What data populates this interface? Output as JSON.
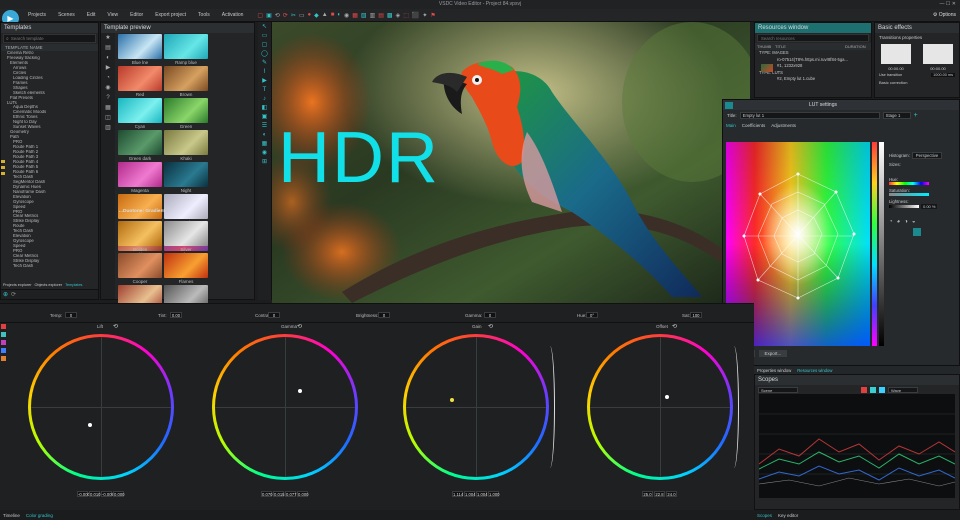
{
  "app": {
    "title": "VSDC Video Editor - Project 84.vpsvj"
  },
  "menu": [
    "Projects",
    "Scenes",
    "Edit",
    "View",
    "Editor",
    "Export project",
    "Tools",
    "Activation"
  ],
  "options_label": "Options",
  "templates": {
    "title": "Templates",
    "search_placeholder": "Search template",
    "header": "TEMPLATE NAME",
    "items": [
      "Cinema Retro",
      "Freeway tracking",
      "Elements",
      "Arrows",
      "Circles",
      "Loading Circles",
      "Frames",
      "Shapes",
      "Sketch elements",
      "Flat Presets",
      "LUTs",
      "Aqua Depths",
      "Cinematic Moods",
      "Ethnic Tones",
      "Night to Day",
      "Sunset Waves",
      "Geometry",
      "Path",
      "PRO",
      "Route Path 1",
      "Route Path 2",
      "Route Path 3",
      "Route Path 4",
      "Route Path 5",
      "Route Path 6",
      "Tech Dash",
      "SegMentor Dash",
      "Dynamic Hues",
      "Nanoframe Dash",
      "Elevation",
      "Gyroscope",
      "Speed",
      "PRO",
      "Clear Metrics",
      "Strike Display",
      "Route",
      "Tech Dash",
      "Elevation",
      "Gyroscope",
      "Speed",
      "PRO",
      "Clear Metrics",
      "Strike Display",
      "Tech Dash"
    ],
    "tabs": [
      "Projects explorer",
      "Objects explorer",
      "Templates"
    ]
  },
  "preview": {
    "title": "Template preview",
    "thumbs": [
      {
        "name": "Blue lne",
        "c1": "#2a6fa8",
        "c2": "#c8e6f5"
      },
      {
        "name": "Ramp blue",
        "c1": "#1fa7b8",
        "c2": "#66e6e6"
      },
      {
        "name": "Red",
        "c1": "#b83a2a",
        "c2": "#f28a6a"
      },
      {
        "name": "Brown",
        "c1": "#7a4a22",
        "c2": "#d6a060"
      },
      {
        "name": "Cyan",
        "c1": "#18b6c0",
        "c2": "#7cf0ee"
      },
      {
        "name": "Green",
        "c1": "#2a7a2a",
        "c2": "#8ad66a"
      },
      {
        "name": "Green dark",
        "c1": "#1e4a30",
        "c2": "#5a9a6a"
      },
      {
        "name": "Khaki",
        "c1": "#7a7a40",
        "c2": "#c8c88a"
      },
      {
        "name": "Magenta",
        "c1": "#b02a8a",
        "c2": "#f07ad0"
      },
      {
        "name": "Night",
        "c1": "#0a3040",
        "c2": "#2a7a90"
      },
      {
        "name": "Orange",
        "c1": "#c86a10",
        "c2": "#f8b050"
      },
      {
        "name": "Negative",
        "c1": "#aab",
        "c2": "#eef"
      },
      {
        "name": "Skin",
        "c1": "#9a3a2a",
        "c2": "#e08a6a"
      },
      {
        "name": "Glory",
        "c1": "#6a3aa0",
        "c2": "#d04a70"
      }
    ],
    "section": "...Duotone: Gradient",
    "thumbs2": [
      {
        "name": "Golden",
        "c1": "#b06a10",
        "c2": "#f5c060"
      },
      {
        "name": "Silver",
        "c1": "#8a8a8a",
        "c2": "#e6e6e6"
      },
      {
        "name": "Cooper",
        "c1": "#8a4a2a",
        "c2": "#e09060"
      },
      {
        "name": "Flames",
        "c1": "#c03010",
        "c2": "#f8a030"
      },
      {
        "name": "Flames and haze",
        "c1": "#a04030",
        "c2": "#e8c090"
      },
      {
        "name": "Grey",
        "c1": "#555",
        "c2": "#bbb"
      },
      {
        "name": "",
        "c1": "#3a3a8a",
        "c2": "#8a8ad0"
      },
      {
        "name": "",
        "c1": "#c03a8a",
        "c2": "#f0a0c0"
      },
      {
        "name": "",
        "c1": "#6ab02a",
        "c2": "#d0f07a"
      }
    ]
  },
  "main_preview": {
    "overlay_text": "HDR"
  },
  "resources": {
    "title": "Resources window",
    "search_placeholder": "Search resources",
    "col_thumb": "THUMB",
    "col_title": "TITLE",
    "col_duration": "DURATION",
    "rows": [
      "TYPE: IMAGES",
      "ro-07514(T8%.https.mi.ruvr8f84-5ga...",
      "#1, 1232x928",
      "TYPE: LUTS",
      "#2, Empty lut 1.cube"
    ]
  },
  "basic_effects": {
    "title": "Basic effects",
    "section": "Transitions properties",
    "in_time": "00:00.00",
    "out_time": "00:00.00",
    "use_transition": "Use transition",
    "time_field": "1000.00 ms",
    "color_correction": "Basic correction"
  },
  "lut": {
    "title": "LUT settings",
    "title_label": "Title:",
    "title_value": "Empty lut 1",
    "stage": "Stage 1",
    "tabs": [
      "Main",
      "Coefficients",
      "Adjustments"
    ],
    "histogram_label": "Histogram:",
    "histogram_value": "Perspective",
    "sizes_label": "Sizes:",
    "hue_label": "Hue:",
    "saturation_label": "Saturation:",
    "lightness_label": "Lightness:",
    "lightness_value": "0.00 %",
    "import": "Import...",
    "export": "Export..."
  },
  "grading": {
    "temp_label": "Temp:",
    "temp_value": "0",
    "tint_label": "Tint:",
    "tint_value": "0.00",
    "contrast_label": "Contrast:",
    "contrast_value": "0",
    "brightness_label": "Brightness:",
    "brightness_value": "0",
    "gamma_label": "Gamma:",
    "gamma_value": "0",
    "hue_label": "Hue:",
    "hue_value": "0°",
    "sat_label": "Sat:",
    "sat_value": "100",
    "wheels": [
      {
        "name": "Lift",
        "values": [
          "-0.000",
          "0.010",
          "-0.009",
          "0.000"
        ]
      },
      {
        "name": "Gamma",
        "values": [
          "0.070",
          "0.015",
          "0.077",
          "0.000"
        ]
      },
      {
        "name": "Gain",
        "values": [
          "1.114",
          "1.004",
          "1.004",
          "1.000"
        ]
      },
      {
        "name": "Offset",
        "values": [
          "25.0",
          "22.8",
          "24.0"
        ]
      }
    ]
  },
  "props": {
    "tabs": [
      "Properties window",
      "Resources window"
    ]
  },
  "scopes": {
    "title": "Scopes",
    "mode": "Scene",
    "wave": "Wave",
    "colors": [
      "#e04040",
      "#38d0d0",
      "#3ad0ff"
    ]
  },
  "bottom_tabs": {
    "left": [
      "Timeline",
      "Color grading"
    ],
    "right": [
      "Scopes",
      "Key editor"
    ]
  }
}
